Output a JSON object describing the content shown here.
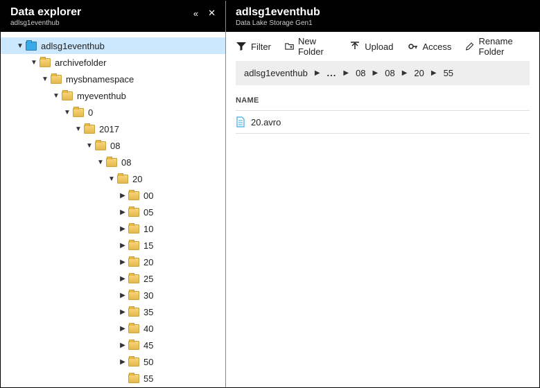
{
  "left": {
    "title": "Data explorer",
    "subtitle": "adlsg1eventhub"
  },
  "right": {
    "title": "adlsg1eventhub",
    "subtitle": "Data Lake Storage Gen1"
  },
  "toolbar": {
    "filter": "Filter",
    "newFolder": "New Folder",
    "upload": "Upload",
    "access": "Access",
    "rename": "Rename Folder"
  },
  "breadcrumb": {
    "root": "adlsg1eventhub",
    "parts": [
      "08",
      "08",
      "20",
      "55"
    ]
  },
  "list": {
    "header": "NAME",
    "items": [
      {
        "name": "20.avro"
      }
    ]
  },
  "tree": {
    "root": "adlsg1eventhub",
    "l1": "archivefolder",
    "l2": "mysbnamespace",
    "l3": "myeventhub",
    "l4": "0",
    "l5": "2017",
    "l6": "08",
    "l7": "08",
    "l8": "20",
    "leaves": [
      "00",
      "05",
      "10",
      "15",
      "20",
      "25",
      "30",
      "35",
      "40",
      "45",
      "50",
      "55"
    ]
  }
}
